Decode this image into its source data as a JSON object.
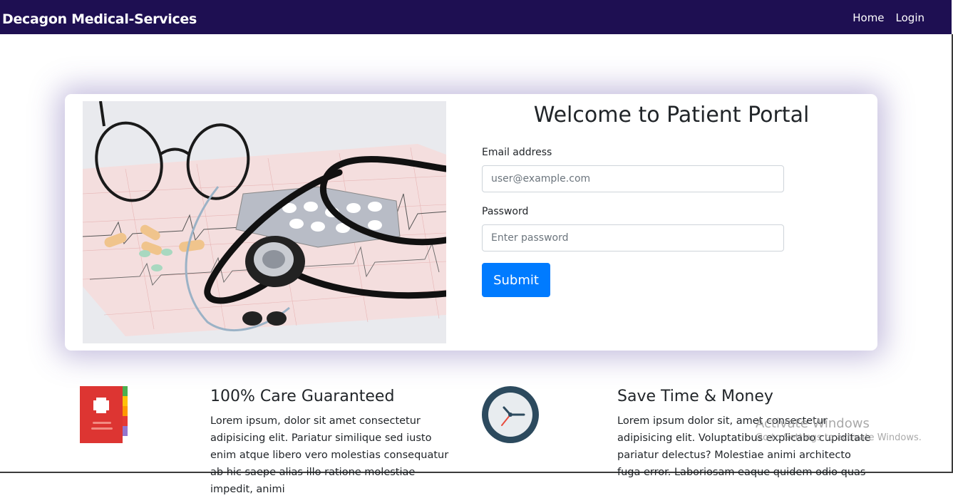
{
  "navbar": {
    "brand": "Decagon Medical-Services",
    "links": [
      "Home",
      "Login"
    ]
  },
  "portal": {
    "title": "Welcome to Patient Portal",
    "email_label": "Email address",
    "email_placeholder": "user@example.com",
    "password_label": "Password",
    "password_placeholder": "Enter password",
    "submit_label": "Submit"
  },
  "features": [
    {
      "title": "100% Care Guaranteed",
      "text": "Lorem ipsum, dolor sit amet consectetur adipisicing elit. Pariatur similique sed iusto enim atque libero vero molestias consequatur ab hic saepe alias illo ratione molestiae impedit, animi",
      "icon": "medical-book-icon"
    },
    {
      "title": "Save Time & Money",
      "text": "Lorem ipsum dolor sit, amet consectetur adipisicing elit. Voluptatibus explicabo cupiditate pariatur delectus? Molestiae animi architecto fuga error. Laboriosam eaque quidem odio quas",
      "icon": "clock-icon"
    }
  ],
  "watermark": {
    "line1": "Activate Windows",
    "line2": "Go to Settings to activate Windows."
  },
  "colors": {
    "navbar": "#1e0f52",
    "primary": "#007bff"
  }
}
